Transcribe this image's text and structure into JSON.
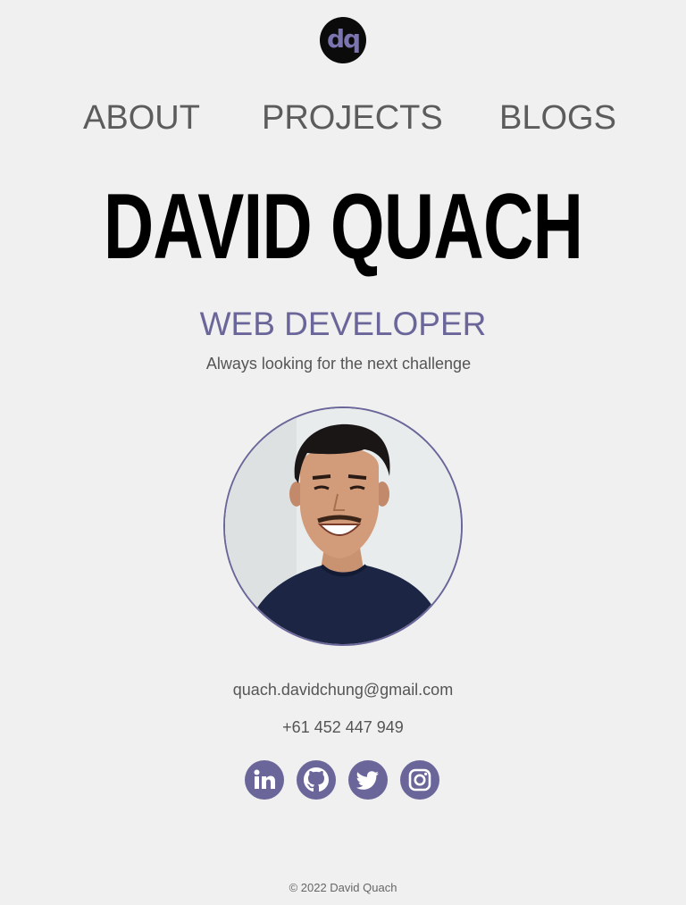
{
  "logo": {
    "text": "dq"
  },
  "nav": {
    "items": [
      "ABOUT",
      "PROJECTS",
      "BLOGS"
    ]
  },
  "hero": {
    "name": "DAVID QUACH",
    "role": "WEB DEVELOPER",
    "tagline": "Always looking for the next challenge"
  },
  "contact": {
    "email": "quach.davidchung@gmail.com",
    "phone": "+61 452 447 949"
  },
  "socials": [
    "linkedin-icon",
    "github-icon",
    "twitter-icon",
    "instagram-icon"
  ],
  "footer": {
    "text": "© 2022 David Quach"
  },
  "colors": {
    "accent": "#6a6699",
    "background": "#f0f0f0",
    "nav_text": "#5c5c5c"
  }
}
